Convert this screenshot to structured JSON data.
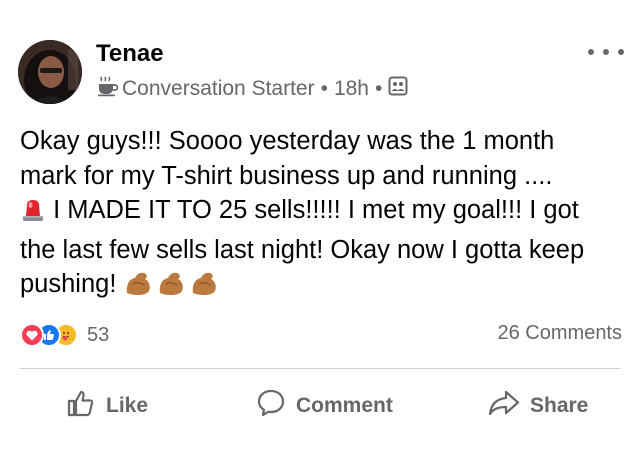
{
  "post": {
    "author": "Tenae",
    "badge_icon": "coffee-cup-icon",
    "badge_label": "Conversation Starter",
    "separator": "•",
    "timestamp": "18h",
    "audience_icon": "group-audience-icon",
    "text_lines": [
      "Okay guys!!! Soooo yesterday was the 1 month",
      "mark for my T-shirt business up and running ....",
      "I MADE IT TO 25 sells!!!!! I met my goal!!! I got",
      "the last few sells last night! Okay now I gotta keep",
      "pushing!"
    ],
    "emojis": [
      "police-light-emoji",
      "flexed-biceps-emoji"
    ]
  },
  "reactions": {
    "types": [
      "love",
      "like",
      "care"
    ],
    "colors": {
      "love": "#f33e58",
      "like": "#1877f2",
      "care": "#f7b928"
    },
    "count": "53"
  },
  "comments_label": "26 Comments",
  "actions": [
    {
      "label": "Like",
      "icon": "thumbs-up-icon"
    },
    {
      "label": "Comment",
      "icon": "comment-bubble-icon"
    },
    {
      "label": "Share",
      "icon": "share-arrow-icon"
    }
  ]
}
